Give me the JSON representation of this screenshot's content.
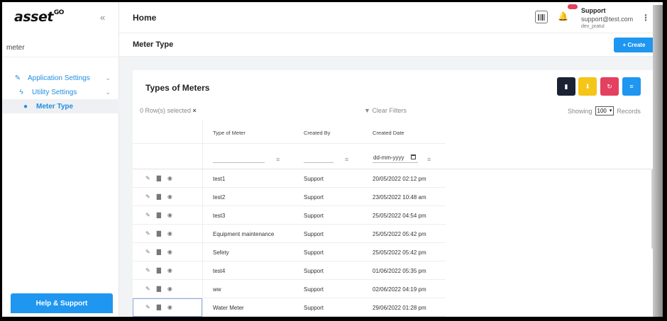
{
  "brand": {
    "logo": "asset",
    "logo_sup": "GO"
  },
  "sidebar": {
    "search_value": "meter",
    "items": [
      {
        "label": "Application Settings",
        "icon": "wrench-icon"
      },
      {
        "label": "Utility Settings",
        "icon": "bolt-icon"
      },
      {
        "label": "Meter Type",
        "icon": "drop-icon"
      }
    ],
    "help_label": "Help & Support"
  },
  "header": {
    "title": "Home",
    "user_name": "Support",
    "user_email": "support@test.com",
    "user_sub": "dev_pratul"
  },
  "page": {
    "title": "Meter Type",
    "create_label": "+ Create"
  },
  "card": {
    "title": "Types of Meters",
    "selected_text": "0 Row(s) selected",
    "clear_filters": "Clear Filters",
    "showing_label": "Showing",
    "records_count": "100",
    "records_label": "Records",
    "date_placeholder": "dd-mm-yyyy"
  },
  "colors": {
    "accent": "#1f96f0",
    "btn_dark": "#1a2233",
    "btn_yellow": "#f5c518",
    "btn_red": "#e4405f",
    "btn_blue": "#1f96f0"
  },
  "table": {
    "columns": [
      "Type of Meter",
      "Created By",
      "Created Date"
    ],
    "rows": [
      {
        "type": "test1",
        "by": "Support",
        "date": "20/05/2022 02:12 pm"
      },
      {
        "type": "test2",
        "by": "Support",
        "date": "23/05/2022 10:48 am"
      },
      {
        "type": "test3",
        "by": "Support",
        "date": "25/05/2022 04:54 pm"
      },
      {
        "type": "Equipment maintenance",
        "by": "Support",
        "date": "25/05/2022 05:42 pm"
      },
      {
        "type": "Sefety",
        "by": "Support",
        "date": "25/05/2022 05:42 pm"
      },
      {
        "type": "test4",
        "by": "Support",
        "date": "01/06/2022 05:35 pm"
      },
      {
        "type": "ww",
        "by": "Support",
        "date": "02/06/2022 04:19 pm"
      },
      {
        "type": "Water Meter",
        "by": "Support",
        "date": "29/06/2022 01:28 pm"
      }
    ]
  }
}
